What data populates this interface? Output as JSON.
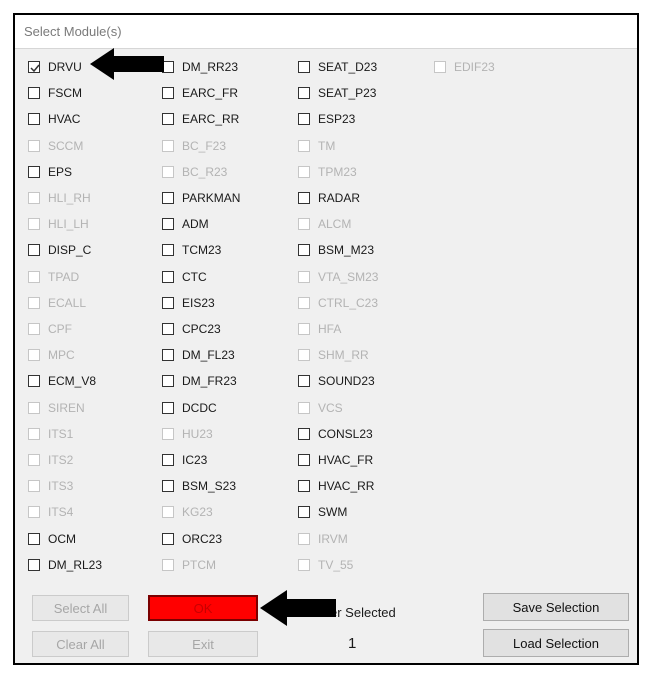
{
  "dialog": {
    "title": "Select Module(s)"
  },
  "modules": [
    [
      {
        "label": "DRVU",
        "enabled": true,
        "checked": true
      },
      {
        "label": "FSCM",
        "enabled": true,
        "checked": false
      },
      {
        "label": "HVAC",
        "enabled": true,
        "checked": false
      },
      {
        "label": "SCCM",
        "enabled": false,
        "checked": false
      },
      {
        "label": "EPS",
        "enabled": true,
        "checked": false
      },
      {
        "label": "HLI_RH",
        "enabled": false,
        "checked": false
      },
      {
        "label": "HLI_LH",
        "enabled": false,
        "checked": false
      },
      {
        "label": "DISP_C",
        "enabled": true,
        "checked": false
      },
      {
        "label": "TPAD",
        "enabled": false,
        "checked": false
      },
      {
        "label": "ECALL",
        "enabled": false,
        "checked": false
      },
      {
        "label": "CPF",
        "enabled": false,
        "checked": false
      },
      {
        "label": "MPC",
        "enabled": false,
        "checked": false
      },
      {
        "label": "ECM_V8",
        "enabled": true,
        "checked": false
      },
      {
        "label": "SIREN",
        "enabled": false,
        "checked": false
      },
      {
        "label": "ITS1",
        "enabled": false,
        "checked": false
      },
      {
        "label": "ITS2",
        "enabled": false,
        "checked": false
      },
      {
        "label": "ITS3",
        "enabled": false,
        "checked": false
      },
      {
        "label": "ITS4",
        "enabled": false,
        "checked": false
      },
      {
        "label": "OCM",
        "enabled": true,
        "checked": false
      },
      {
        "label": "DM_RL23",
        "enabled": true,
        "checked": false
      }
    ],
    [
      {
        "label": "DM_RR23",
        "enabled": true,
        "checked": false
      },
      {
        "label": "EARC_FR",
        "enabled": true,
        "checked": false
      },
      {
        "label": "EARC_RR",
        "enabled": true,
        "checked": false
      },
      {
        "label": "BC_F23",
        "enabled": false,
        "checked": false
      },
      {
        "label": "BC_R23",
        "enabled": false,
        "checked": false
      },
      {
        "label": "PARKMAN",
        "enabled": true,
        "checked": false
      },
      {
        "label": "ADM",
        "enabled": true,
        "checked": false
      },
      {
        "label": "TCM23",
        "enabled": true,
        "checked": false
      },
      {
        "label": "CTC",
        "enabled": true,
        "checked": false
      },
      {
        "label": "EIS23",
        "enabled": true,
        "checked": false
      },
      {
        "label": "CPC23",
        "enabled": true,
        "checked": false
      },
      {
        "label": "DM_FL23",
        "enabled": true,
        "checked": false
      },
      {
        "label": "DM_FR23",
        "enabled": true,
        "checked": false
      },
      {
        "label": "DCDC",
        "enabled": true,
        "checked": false
      },
      {
        "label": "HU23",
        "enabled": false,
        "checked": false
      },
      {
        "label": "IC23",
        "enabled": true,
        "checked": false
      },
      {
        "label": "BSM_S23",
        "enabled": true,
        "checked": false
      },
      {
        "label": "KG23",
        "enabled": false,
        "checked": false
      },
      {
        "label": "ORC23",
        "enabled": true,
        "checked": false
      },
      {
        "label": "PTCM",
        "enabled": false,
        "checked": false
      }
    ],
    [
      {
        "label": "SEAT_D23",
        "enabled": true,
        "checked": false
      },
      {
        "label": "SEAT_P23",
        "enabled": true,
        "checked": false
      },
      {
        "label": "ESP23",
        "enabled": true,
        "checked": false
      },
      {
        "label": "TM",
        "enabled": false,
        "checked": false
      },
      {
        "label": "TPM23",
        "enabled": false,
        "checked": false
      },
      {
        "label": "RADAR",
        "enabled": true,
        "checked": false
      },
      {
        "label": "ALCM",
        "enabled": false,
        "checked": false
      },
      {
        "label": "BSM_M23",
        "enabled": true,
        "checked": false
      },
      {
        "label": "VTA_SM23",
        "enabled": false,
        "checked": false
      },
      {
        "label": "CTRL_C23",
        "enabled": false,
        "checked": false
      },
      {
        "label": "HFA",
        "enabled": false,
        "checked": false
      },
      {
        "label": "SHM_RR",
        "enabled": false,
        "checked": false
      },
      {
        "label": "SOUND23",
        "enabled": true,
        "checked": false
      },
      {
        "label": "VCS",
        "enabled": false,
        "checked": false
      },
      {
        "label": "CONSL23",
        "enabled": true,
        "checked": false
      },
      {
        "label": "HVAC_FR",
        "enabled": true,
        "checked": false
      },
      {
        "label": "HVAC_RR",
        "enabled": true,
        "checked": false
      },
      {
        "label": "SWM",
        "enabled": true,
        "checked": false
      },
      {
        "label": "IRVM",
        "enabled": false,
        "checked": false
      },
      {
        "label": "TV_55",
        "enabled": false,
        "checked": false
      }
    ],
    [
      {
        "label": "EDIF23",
        "enabled": false,
        "checked": false
      }
    ]
  ],
  "buttons": {
    "select_all": "Select All",
    "clear_all": "Clear All",
    "ok": "OK",
    "exit": "Exit",
    "save_selection": "Save Selection",
    "load_selection": "Load Selection"
  },
  "number_selected": {
    "label_visible": "er Selected",
    "value": "1"
  },
  "annotations": {
    "arrow_color": "#000000",
    "highlight_color": "#ff0000"
  }
}
